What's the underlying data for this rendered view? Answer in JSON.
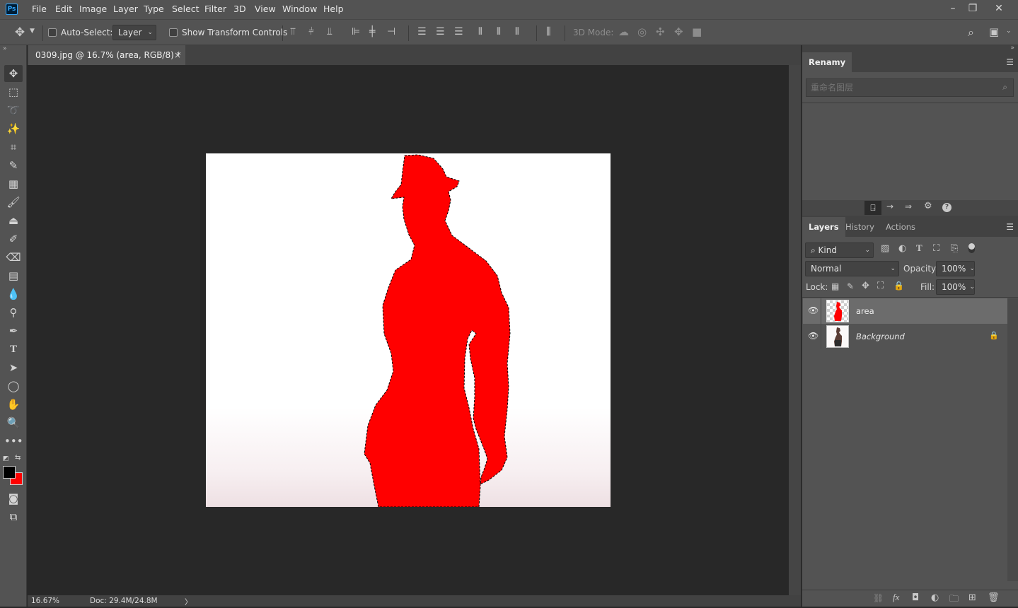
{
  "app": {
    "logo": "Ps"
  },
  "menu": [
    "File",
    "Edit",
    "Image",
    "Layer",
    "Type",
    "Select",
    "Filter",
    "3D",
    "View",
    "Window",
    "Help"
  ],
  "window_controls": {
    "minimize": "–",
    "restore": "❐",
    "close": "✕"
  },
  "options": {
    "auto_select_label": "Auto-Select:",
    "auto_select_target": "Layer",
    "transform_controls_label": "Show Transform Controls",
    "mode_3d_label": "3D Mode:"
  },
  "document": {
    "tab_title": "0309.jpg @ 16.7% (area, RGB/8) *",
    "close_glyph": "×"
  },
  "status": {
    "zoom": "16.67%",
    "doc_size": "Doc: 29.4M/24.8M",
    "arrow": "〉"
  },
  "renamy": {
    "tab_label": "Renamy",
    "search_placeholder": "重命名图层"
  },
  "layers_panel": {
    "tabs": [
      "Layers",
      "History",
      "Actions"
    ],
    "filter_kind": "Kind",
    "blend_mode": "Normal",
    "opacity_label": "Opacity:",
    "opacity_value": "100%",
    "lock_label": "Lock:",
    "fill_label": "Fill:",
    "fill_value": "100%",
    "layers": [
      {
        "name": "area",
        "selected": true,
        "locked": false
      },
      {
        "name": "Background",
        "selected": false,
        "locked": true
      }
    ]
  },
  "colors": {
    "accent_blue": "#31a8ff",
    "foreground_swatch": "#000000",
    "background_swatch": "#ff0000",
    "selection_fill": "#ff0000"
  }
}
